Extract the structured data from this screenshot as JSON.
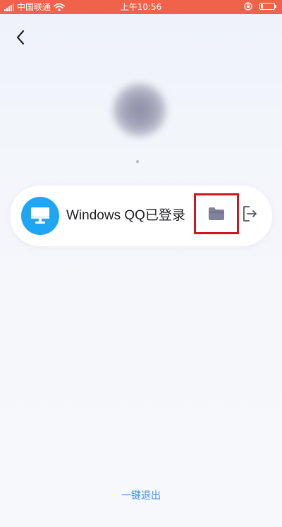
{
  "status_bar": {
    "carrier": "中国联通",
    "time": "上午10:56",
    "icons": [
      "signal-icon",
      "wifi-icon",
      "lock-rotate-icon",
      "battery-icon"
    ],
    "battery_level": 0.15
  },
  "header": {
    "back_icon": "chevron-left-icon"
  },
  "device": {
    "icon": "desktop-monitor-icon",
    "label": "Windows QQ已登录",
    "file_icon": "folder-icon",
    "logout_icon": "exit-icon"
  },
  "footer": {
    "quick_logout": "一键退出"
  },
  "colors": {
    "status_bar": "#f0634a",
    "computer_avatar": "#1ea6f5",
    "highlight_box": "#d4141e",
    "link": "#3d8bf2"
  }
}
